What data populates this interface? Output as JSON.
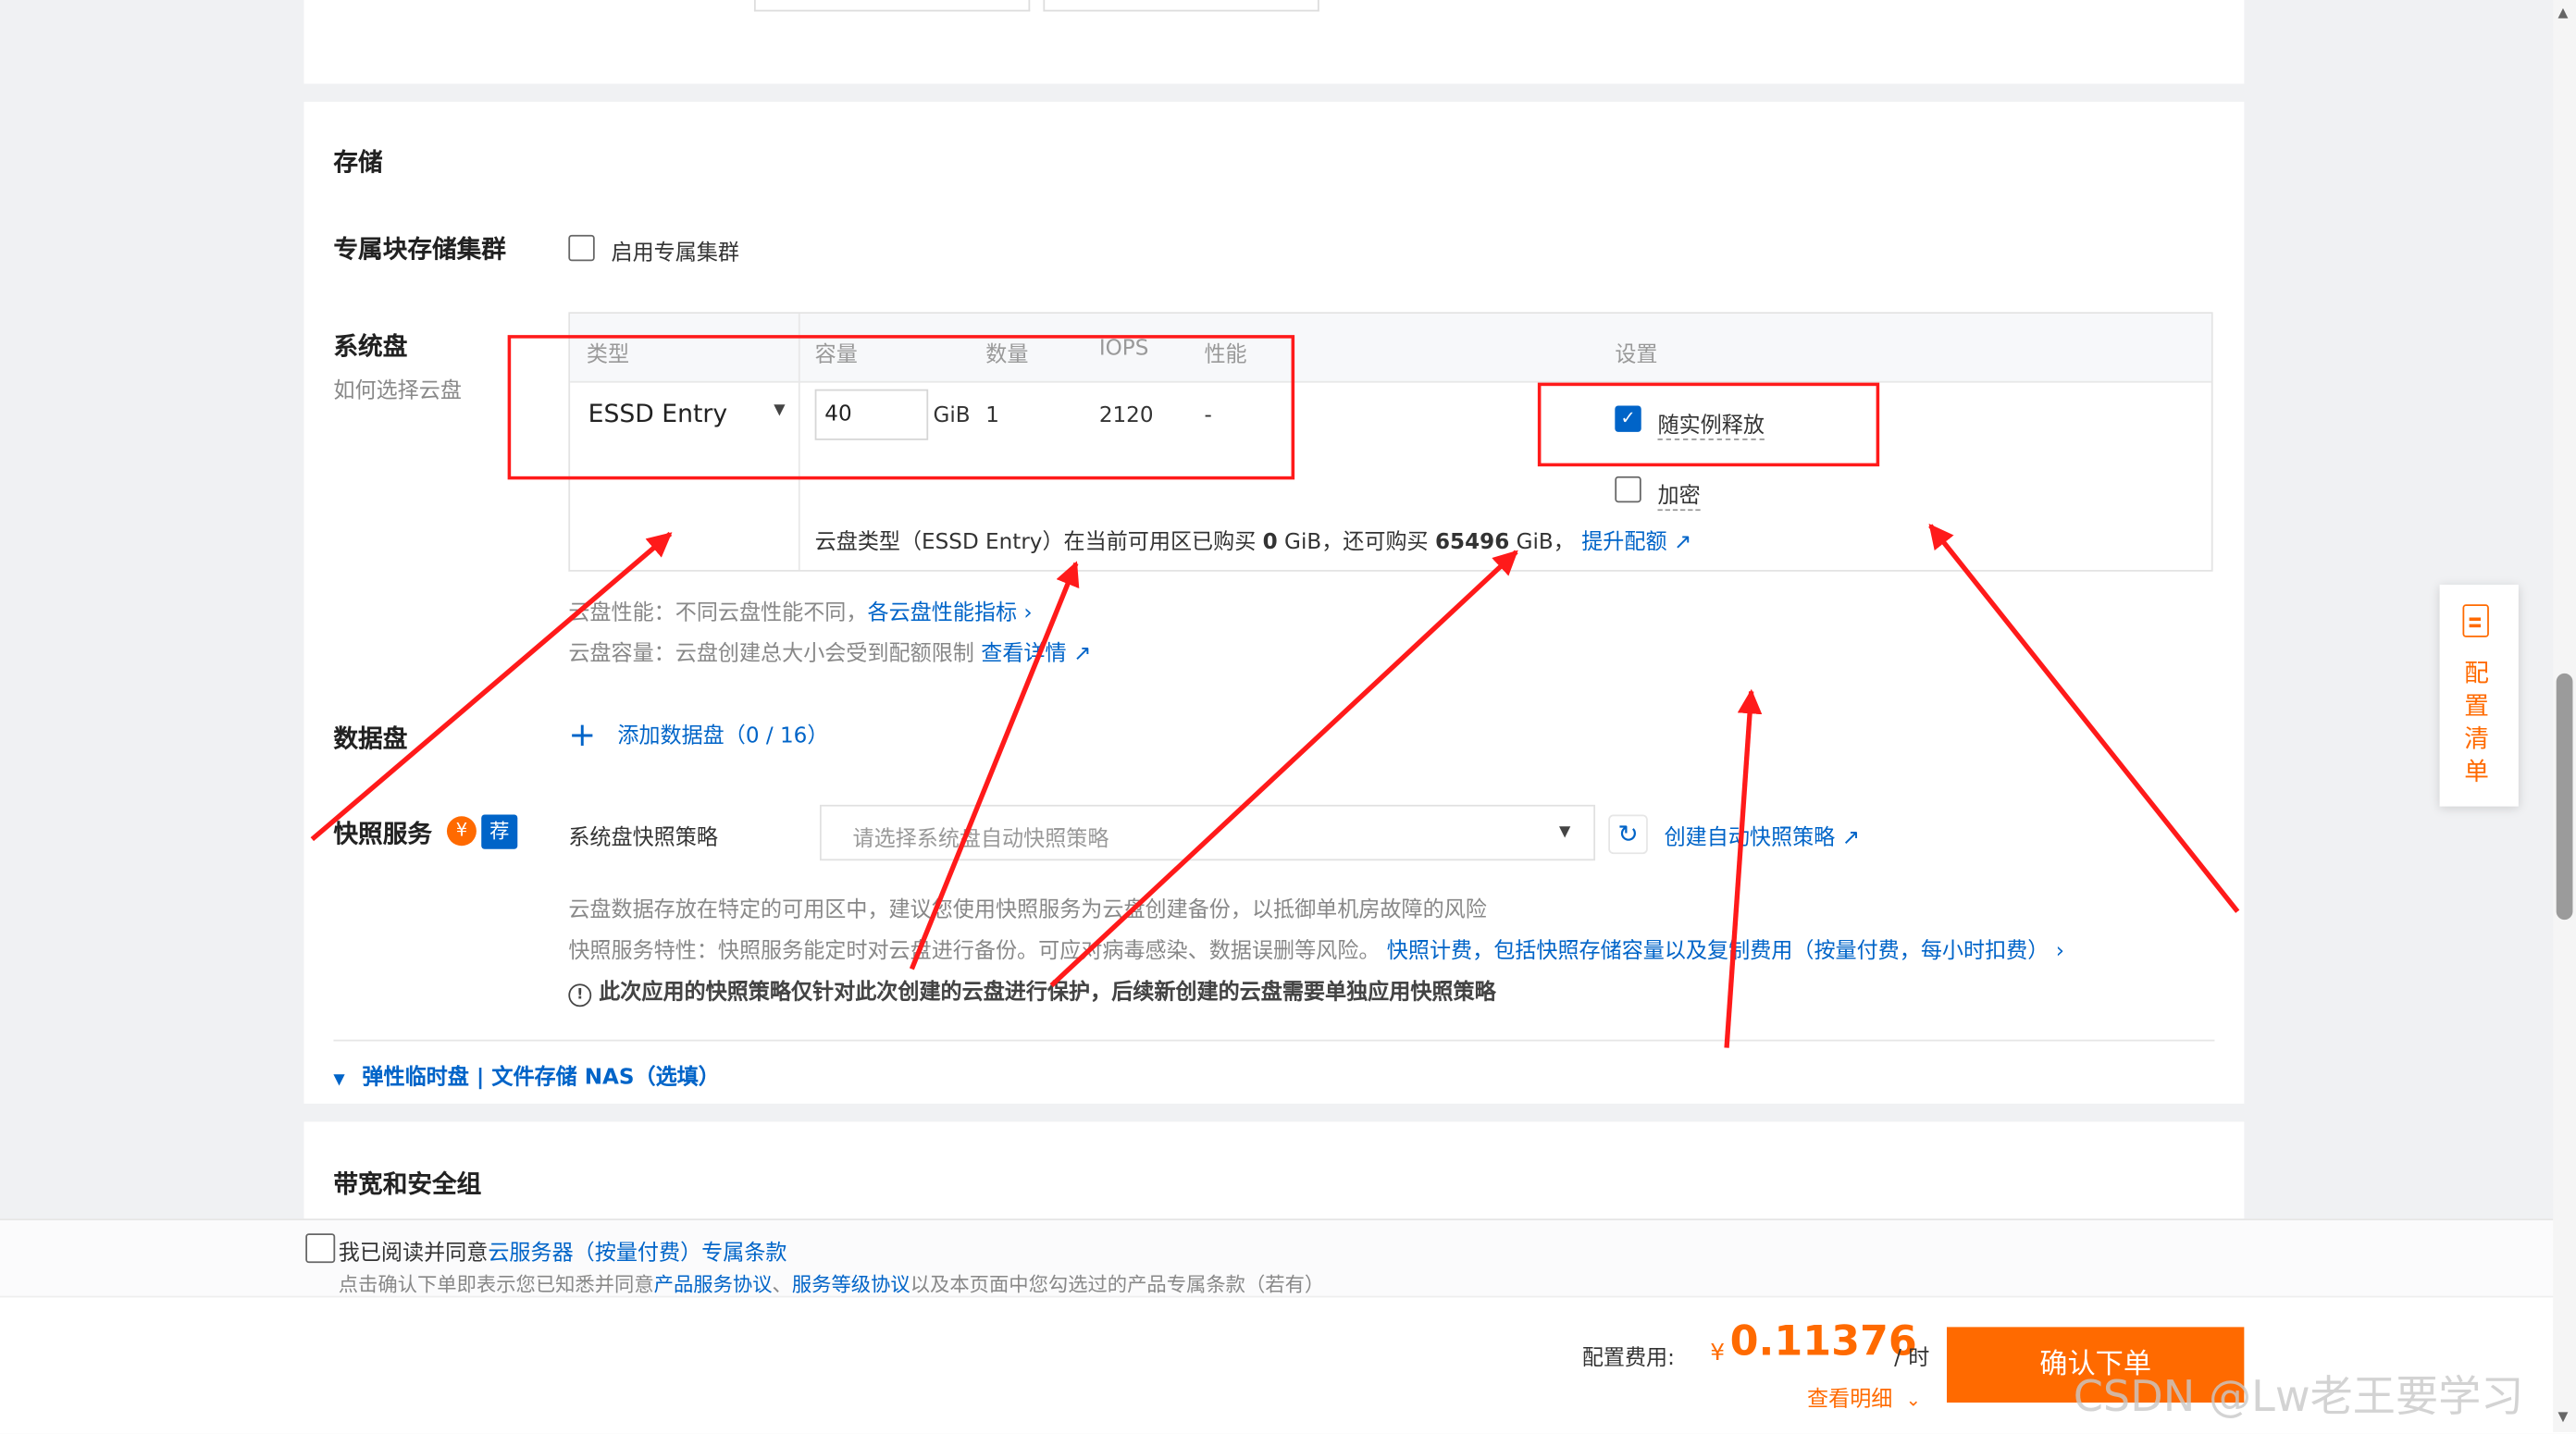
{
  "storage": {
    "section_title": "存储",
    "dedicated_cluster": {
      "label": "专属块存储集群",
      "checkbox_label": "启用专属集群"
    },
    "system_disk": {
      "label": "系统盘",
      "help_link": "如何选择云盘",
      "headers": {
        "type": "类型",
        "capacity": "容量",
        "count": "数量",
        "iops": "IOPS",
        "performance": "性能",
        "settings": "设置"
      },
      "type_value": "ESSD Entry",
      "capacity_value": "40",
      "capacity_unit": "GiB",
      "count_value": "1",
      "iops_value": "2120",
      "performance_value": "-",
      "release_with_instance": {
        "label": "随实例释放",
        "checked": true
      },
      "encrypt": {
        "label": "加密",
        "checked": false
      },
      "quota": {
        "prefix": "云盘类型（ESSD Entry）在当前可用区已购买",
        "bought": "0",
        "middle": "GiB，还可购买",
        "remaining": "65496",
        "suffix": "GiB，",
        "link": "提升配额"
      }
    },
    "notes": {
      "perf_label": "云盘性能：不同云盘性能不同，",
      "perf_link": "各云盘性能指标",
      "cap_label": "云盘容量：云盘创建总大小会受到配额限制",
      "cap_link": "查看详情"
    },
    "data_disk": {
      "label": "数据盘",
      "add_label": "添加数据盘（0 / 16）"
    },
    "snapshot": {
      "label": "快照服务",
      "badge_yen": "¥",
      "badge_rec": "荐",
      "policy_label": "系统盘快照策略",
      "policy_placeholder": "请选择系统盘自动快照策略",
      "create_link": "创建自动快照策略",
      "desc1": "云盘数据存放在特定的可用区中，建议您使用快照服务为云盘创建备份，以抵御单机房故障的风险",
      "desc2_prefix": "快照服务特性：快照服务能定时对云盘进行备份。可应对病毒感染、数据误删等风险。",
      "desc2_link": "快照计费，包括快照存储容量以及复制费用（按量付费，每小时扣费）",
      "warning": "此次应用的快照策略仅针对此次创建的云盘进行保护，后续新创建的云盘需要单独应用快照策略"
    },
    "more": {
      "link1": "弹性临时盘",
      "sep": "|",
      "link2": "文件存储 NAS（选填）"
    }
  },
  "network": {
    "section_title": "带宽和安全组"
  },
  "config_list": {
    "label": "配置清单"
  },
  "agreement": {
    "prefix": "我已阅读并同意",
    "link": "云服务器（按量付费）专属条款",
    "note_prefix": "点击确认下单即表示您已知悉并同意",
    "note_link1": "产品服务协议",
    "note_sep": "、",
    "note_link2": "服务等级协议",
    "note_suffix": "以及本页面中您勾选过的产品专属条款（若有）"
  },
  "footer": {
    "fee_label": "配置费用:",
    "currency": "¥",
    "price": "0.11376",
    "unit": "/ 时",
    "detail_link": "查看明细",
    "confirm_button": "确认下单",
    "watermark": "CSDN @Lw老王要学习"
  },
  "colors": {
    "accent": "#0064c8",
    "orange": "#ff6a00",
    "annotation": "#ff1a1a"
  }
}
